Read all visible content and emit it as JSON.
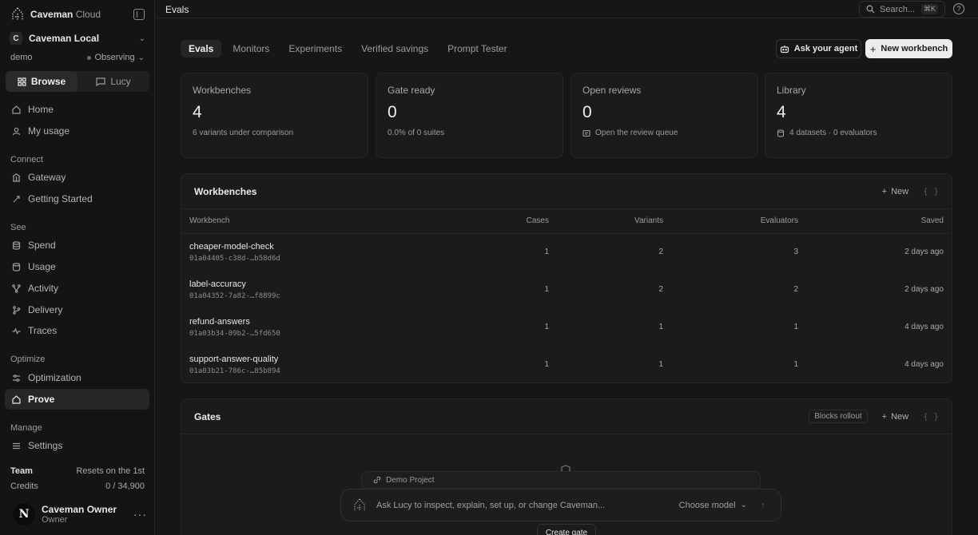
{
  "brand": {
    "name_bold": "Caveman",
    "name_light": "Cloud"
  },
  "org": {
    "initial": "C",
    "name": "Caveman Local"
  },
  "env": {
    "name": "demo",
    "mode": "Observing"
  },
  "switcher": {
    "browse": "Browse",
    "lucy": "Lucy"
  },
  "nav": {
    "home": "Home",
    "usage_me": "My usage",
    "sec_connect": "Connect",
    "gateway": "Gateway",
    "getting_started": "Getting Started",
    "sec_see": "See",
    "spend": "Spend",
    "usage": "Usage",
    "activity": "Activity",
    "delivery": "Delivery",
    "traces": "Traces",
    "sec_optimize": "Optimize",
    "optimization": "Optimization",
    "prove": "Prove",
    "sec_manage": "Manage",
    "settings": "Settings"
  },
  "team": {
    "label": "Team",
    "resets": "Resets on the 1st",
    "credits_label": "Credits",
    "credits_value": "0 / 34,900"
  },
  "user": {
    "initial": "N",
    "name": "Caveman Owner",
    "role": "Owner"
  },
  "topbar": {
    "title": "Evals",
    "search_placeholder": "Search...",
    "search_kbd": "⌘K"
  },
  "tabs": [
    "Evals",
    "Monitors",
    "Experiments",
    "Verified savings",
    "Prompt Tester"
  ],
  "actions": {
    "ask_agent": "Ask your agent",
    "new_workbench": "New workbench"
  },
  "stats": [
    {
      "label": "Workbenches",
      "value": "4",
      "sub": "6 variants under comparison"
    },
    {
      "label": "Gate ready",
      "value": "0",
      "sub": "0.0% of 0 suites"
    },
    {
      "label": "Open reviews",
      "value": "0",
      "sub": "Open the review queue"
    },
    {
      "label": "Library",
      "value": "4",
      "sub": "4 datasets · 0 evaluators"
    }
  ],
  "workbenches": {
    "title": "Workbenches",
    "new_label": "New",
    "brace": "{ }",
    "columns": [
      "Workbench",
      "Cases",
      "Variants",
      "Evaluators",
      "Saved"
    ],
    "rows": [
      {
        "name": "cheaper-model-check",
        "id": "01a04405-c38d-…b58d6d",
        "cases": "1",
        "variants": "2",
        "evaluators": "3",
        "saved": "2 days ago"
      },
      {
        "name": "label-accuracy",
        "id": "01a04352-7a82-…f8899c",
        "cases": "1",
        "variants": "2",
        "evaluators": "2",
        "saved": "2 days ago"
      },
      {
        "name": "refund-answers",
        "id": "01a03b34-09b2-…5fd650",
        "cases": "1",
        "variants": "1",
        "evaluators": "1",
        "saved": "4 days ago"
      },
      {
        "name": "support-answer-quality",
        "id": "01a03b21-786c-…85b894",
        "cases": "1",
        "variants": "1",
        "evaluators": "1",
        "saved": "4 days ago"
      }
    ]
  },
  "gates": {
    "title": "Gates",
    "pill": "Blocks rollout",
    "new_label": "New",
    "brace": "{ }",
    "create": "Create gate"
  },
  "chat": {
    "context": "Demo Project",
    "placeholder": "Ask Lucy to inspect, explain, set up, or change Caveman...",
    "model": "Choose model"
  }
}
